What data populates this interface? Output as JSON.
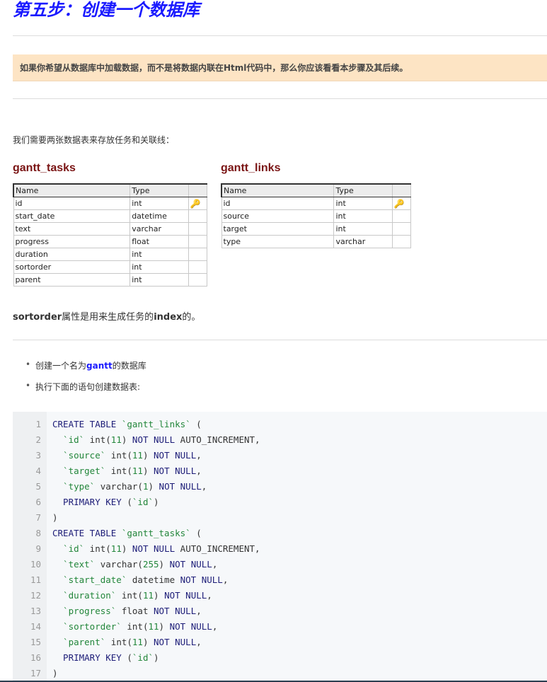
{
  "title": "第五步：创建一个数据库",
  "callout": "如果你希望从数据库中加载数据，而不是将数据内联在Html代码中，那么你应该看看本步骤及其后续。",
  "intro": "我们需要两张数据表来存放任务和关联线：",
  "tables": [
    {
      "name": "gantt_tasks",
      "headers": [
        "Name",
        "Type"
      ],
      "rows": [
        [
          "id",
          "int",
          true
        ],
        [
          "start_date",
          "datetime",
          false
        ],
        [
          "text",
          "varchar",
          false
        ],
        [
          "progress",
          "float",
          false
        ],
        [
          "duration",
          "int",
          false
        ],
        [
          "sortorder",
          "int",
          false
        ],
        [
          "parent",
          "int",
          false
        ]
      ]
    },
    {
      "name": "gantt_links",
      "headers": [
        "Name",
        "Type"
      ],
      "rows": [
        [
          "id",
          "int",
          true
        ],
        [
          "source",
          "int",
          false
        ],
        [
          "target",
          "int",
          false
        ],
        [
          "type",
          "varchar",
          false
        ]
      ]
    }
  ],
  "note": {
    "b1": "sortorder",
    "t1": "属性是用来生成任务的",
    "b2": "index",
    "t2": "的。"
  },
  "bullets": [
    {
      "pre": "创建一个名为",
      "hl": "gantt",
      "post": "的数据库"
    },
    {
      "pre": "执行下面的语句创建数据表:",
      "hl": "",
      "post": ""
    }
  ],
  "code": [
    [
      [
        "CREATE TABLE ",
        "k"
      ],
      [
        "`gantt_links`",
        "s"
      ],
      [
        " (",
        "t"
      ]
    ],
    [
      [
        "  `id`",
        "s"
      ],
      [
        " int(",
        "t"
      ],
      [
        "11",
        "n"
      ],
      [
        ") ",
        "t"
      ],
      [
        "NOT NULL",
        "k"
      ],
      [
        " AUTO_INCREMENT,",
        "t"
      ]
    ],
    [
      [
        "  `source`",
        "s"
      ],
      [
        " int(",
        "t"
      ],
      [
        "11",
        "n"
      ],
      [
        ") ",
        "t"
      ],
      [
        "NOT NULL",
        "k"
      ],
      [
        ",",
        "t"
      ]
    ],
    [
      [
        "  `target`",
        "s"
      ],
      [
        " int(",
        "t"
      ],
      [
        "11",
        "n"
      ],
      [
        ") ",
        "t"
      ],
      [
        "NOT NULL",
        "k"
      ],
      [
        ",",
        "t"
      ]
    ],
    [
      [
        "  `type`",
        "s"
      ],
      [
        " varchar(",
        "t"
      ],
      [
        "1",
        "n"
      ],
      [
        ") ",
        "t"
      ],
      [
        "NOT NULL",
        "k"
      ],
      [
        ",",
        "t"
      ]
    ],
    [
      [
        "  PRIMARY KEY ",
        "k"
      ],
      [
        "(",
        "t"
      ],
      [
        "`id`",
        "s"
      ],
      [
        ")",
        "t"
      ]
    ],
    [
      [
        ")",
        "t"
      ]
    ],
    [
      [
        "CREATE TABLE ",
        "k"
      ],
      [
        "`gantt_tasks`",
        "s"
      ],
      [
        " (",
        "t"
      ]
    ],
    [
      [
        "  `id`",
        "s"
      ],
      [
        " int(",
        "t"
      ],
      [
        "11",
        "n"
      ],
      [
        ") ",
        "t"
      ],
      [
        "NOT NULL",
        "k"
      ],
      [
        " AUTO_INCREMENT,",
        "t"
      ]
    ],
    [
      [
        "  `text`",
        "s"
      ],
      [
        " varchar(",
        "t"
      ],
      [
        "255",
        "n"
      ],
      [
        ") ",
        "t"
      ],
      [
        "NOT NULL",
        "k"
      ],
      [
        ",",
        "t"
      ]
    ],
    [
      [
        "  `start_date`",
        "s"
      ],
      [
        " datetime ",
        "t"
      ],
      [
        "NOT NULL",
        "k"
      ],
      [
        ",",
        "t"
      ]
    ],
    [
      [
        "  `duration`",
        "s"
      ],
      [
        " int(",
        "t"
      ],
      [
        "11",
        "n"
      ],
      [
        ") ",
        "t"
      ],
      [
        "NOT NULL",
        "k"
      ],
      [
        ",",
        "t"
      ]
    ],
    [
      [
        "  `progress`",
        "s"
      ],
      [
        " float ",
        "t"
      ],
      [
        "NOT NULL",
        "k"
      ],
      [
        ",",
        "t"
      ]
    ],
    [
      [
        "  `sortorder`",
        "s"
      ],
      [
        " int(",
        "t"
      ],
      [
        "11",
        "n"
      ],
      [
        ") ",
        "t"
      ],
      [
        "NOT NULL",
        "k"
      ],
      [
        ",",
        "t"
      ]
    ],
    [
      [
        "  `parent`",
        "s"
      ],
      [
        " int(",
        "t"
      ],
      [
        "11",
        "n"
      ],
      [
        ") ",
        "t"
      ],
      [
        "NOT NULL",
        "k"
      ],
      [
        ",",
        "t"
      ]
    ],
    [
      [
        "  PRIMARY KEY ",
        "k"
      ],
      [
        "(",
        "t"
      ],
      [
        "`id`",
        "s"
      ],
      [
        ")",
        "t"
      ]
    ],
    [
      [
        ")",
        "t"
      ]
    ]
  ]
}
